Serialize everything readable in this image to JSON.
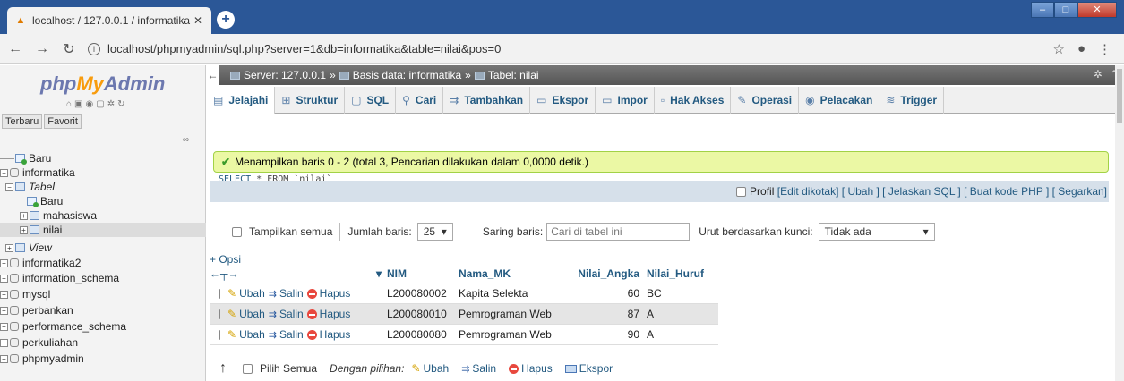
{
  "browser": {
    "tab_title": "localhost / 127.0.0.1 / informatika",
    "url": "localhost/phpmyadmin/sql.php?server=1&db=informatika&table=nilai&pos=0"
  },
  "nav": {
    "logo_php": "php",
    "logo_my": "My",
    "logo_admin": "Admin",
    "recent": "Terbaru",
    "favorite": "Favorit",
    "tree": {
      "new": "Baru",
      "db_informatika": "informatika",
      "tables_group": "Tabel",
      "tables_new": "Baru",
      "table_mahasiswa": "mahasiswa",
      "table_nilai": "nilai",
      "views_group": "View",
      "other_dbs": [
        "informatika2",
        "information_schema",
        "mysql",
        "perbankan",
        "performance_schema",
        "perkuliahan",
        "phpmyadmin"
      ]
    }
  },
  "breadcrumb": {
    "server": "Server: 127.0.0.1",
    "database": "Basis data: informatika",
    "table": "Tabel: nilai"
  },
  "tabs": [
    "Jelajahi",
    "Struktur",
    "SQL",
    "Cari",
    "Tambahkan",
    "Ekspor",
    "Impor",
    "Hak Akses",
    "Operasi",
    "Pelacakan",
    "Trigger"
  ],
  "message": {
    "success": "Menampilkan baris 0 - 2 (total 3, Pencarian dilakukan dalam 0,0000 detik.)",
    "sql_keyword": "SELECT",
    "sql_rest": " * FROM `nilai`"
  },
  "profile": {
    "profil": "Profil",
    "links": [
      "[Edit dikotak]",
      "[ Ubah ]",
      "[ Jelaskan SQL ]",
      "[ Buat kode PHP ]",
      "[ Segarkan]"
    ]
  },
  "controls": {
    "show_all": "Tampilkan semua",
    "rows_label": "Jumlah baris:",
    "rows_value": "25",
    "filter_label": "Saring baris:",
    "filter_placeholder": "Cari di tabel ini",
    "sort_label": "Urut berdasarkan kunci:",
    "sort_value": "Tidak ada"
  },
  "table": {
    "options": "+ Opsi",
    "headers": [
      "NIM",
      "Nama_MK",
      "Nilai_Angka",
      "Nilai_Huruf"
    ],
    "actions": [
      "Ubah",
      "Salin",
      "Hapus"
    ],
    "rows": [
      [
        "L200080002",
        "Kapita Selekta",
        "60",
        "BC"
      ],
      [
        "L200080010",
        "Pemrograman Web",
        "87",
        "A"
      ],
      [
        "L200080080",
        "Pemrograman Web",
        "90",
        "A"
      ]
    ]
  },
  "footer": {
    "check_all": "Pilih Semua",
    "with_selected": "Dengan pilihan:",
    "edit": "Ubah",
    "copy": "Salin",
    "delete": "Hapus",
    "export": "Ekspor"
  }
}
